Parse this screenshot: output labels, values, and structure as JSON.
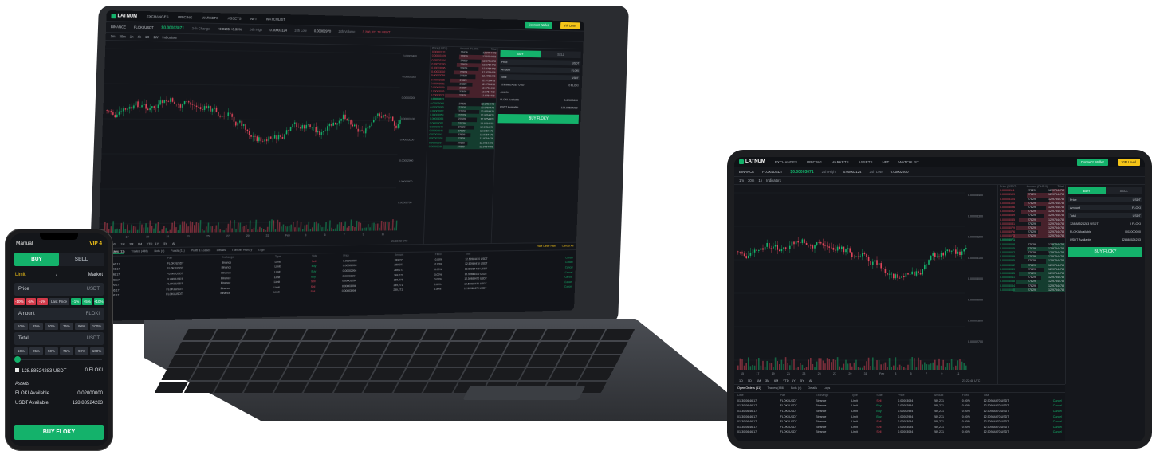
{
  "app": {
    "brand": "LATNUM",
    "nav": [
      "EXCHANGES",
      "PRICING",
      "MARKETS",
      "ASSETS",
      "NFT",
      "WATCHLIST"
    ],
    "connect_label": "Connect Wallet",
    "vip_label": "VIP Level",
    "exchange": "BINANCE",
    "pair": "FLOKI/USDT",
    "last_price": "$0.00003071",
    "stats": [
      {
        "label": "24h Change",
        "value": "+0.0105 +0.93%"
      },
      {
        "label": "24h High",
        "value": "0.00003124"
      },
      {
        "label": "24h Low",
        "value": "0.00002970"
      },
      {
        "label": "24h Volume",
        "value": "3,200,321.74 USDT"
      }
    ],
    "intervals": [
      "1m",
      "30m",
      "1h",
      "4h",
      "1D",
      "1W"
    ],
    "indicators_label": "Indicators",
    "chart_time_labels": [
      "15",
      "17",
      "19",
      "21",
      "23",
      "25",
      "27",
      "29",
      "31",
      "Feb",
      "3",
      "5",
      "7",
      "9",
      "11"
    ],
    "chart_price_labels": [
      "0.00003400",
      "0.00003300",
      "0.00003200",
      "0.00003100",
      "0.00003000",
      "0.00002900",
      "0.00002800",
      "0.00002700"
    ],
    "ranges": [
      "1D",
      "5D",
      "1M",
      "3M",
      "6M",
      "YTD",
      "1Y",
      "5Y",
      "All"
    ],
    "clock": "21:22:48 UTC",
    "orderbook_headers": [
      "Price (USDT)",
      "Amount (FLOKI)",
      "Total"
    ],
    "orderbook_mid": "0.00003071",
    "ob_asks": [
      [
        "0.00003111",
        "27829",
        "12.9754478"
      ],
      [
        "0.00003109",
        "27829",
        "12.9754478"
      ],
      [
        "0.00003104",
        "27829",
        "12.9754478"
      ],
      [
        "0.00003100",
        "27829",
        "12.9754478"
      ],
      [
        "0.00003096",
        "27829",
        "12.9754478"
      ],
      [
        "0.00003092",
        "27829",
        "12.9754478"
      ],
      [
        "0.00003089",
        "27829",
        "12.9754478"
      ],
      [
        "0.00003085",
        "27829",
        "12.9754478"
      ],
      [
        "0.00003081",
        "27829",
        "12.9754478"
      ],
      [
        "0.00003079",
        "27829",
        "12.9754478"
      ],
      [
        "0.00003076",
        "27829",
        "12.9754478"
      ],
      [
        "0.00003073",
        "27829",
        "12.9754478"
      ]
    ],
    "ob_bids": [
      [
        "0.00003068",
        "27829",
        "12.9754478"
      ],
      [
        "0.00003065",
        "27829",
        "12.9754478"
      ],
      [
        "0.00003062",
        "27829",
        "12.9754478"
      ],
      [
        "0.00003059",
        "27829",
        "12.9754478"
      ],
      [
        "0.00003055",
        "27829",
        "12.9754478"
      ],
      [
        "0.00003052",
        "27829",
        "12.9754478"
      ],
      [
        "0.00003049",
        "27829",
        "12.9754478"
      ],
      [
        "0.00003045",
        "27829",
        "12.9754478"
      ],
      [
        "0.00003041",
        "27829",
        "12.9754478"
      ],
      [
        "0.00003038",
        "27829",
        "12.9754478"
      ],
      [
        "0.00003034",
        "27829",
        "12.9754478"
      ],
      [
        "0.00003030",
        "27829",
        "12.9754478"
      ]
    ],
    "order_tabs": [
      "Open Orders (11)",
      "Trades (486)",
      "Bots (4)",
      "Funds (11)",
      "Profit & Losses",
      "Details",
      "Transfer History",
      "Logs"
    ],
    "hide_other_pairs": "Hide Other Pairs",
    "cancel_all": "Cancel All",
    "order_headers": [
      "Date",
      "Pair",
      "Exchange",
      "Type",
      "Side",
      "Price",
      "Amount",
      "Filled",
      "Total",
      ""
    ],
    "orders": [
      [
        "01-30 06:46:17",
        "FLOKI/USDT",
        "Binance",
        "Limit",
        "Sell",
        "0.00003094",
        "289,271",
        "0.00%",
        "12.50984470 USDT",
        "Cancel"
      ],
      [
        "01-30 06:46:17",
        "FLOKI/USDT",
        "Binance",
        "Limit",
        "Buy",
        "0.00002994",
        "289,271",
        "0.00%",
        "12.50984470 USDT",
        "Cancel"
      ],
      [
        "01-30 06:46:17",
        "FLOKI/USDT",
        "Binance",
        "Limit",
        "Buy",
        "0.00002994",
        "289,271",
        "0.00%",
        "12.50984470 USDT",
        "Cancel"
      ],
      [
        "01-30 06:46:17",
        "FLOKI/USDT",
        "Binance",
        "Limit",
        "Buy",
        "0.00002994",
        "289,271",
        "0.00%",
        "12.50984470 USDT",
        "Cancel"
      ],
      [
        "01-30 06:46:17",
        "FLOKI/USDT",
        "Binance",
        "Limit",
        "Sell",
        "0.00003094",
        "289,271",
        "0.00%",
        "12.50984470 USDT",
        "Cancel"
      ],
      [
        "01-30 06:46:17",
        "FLOKI/USDT",
        "Binance",
        "Limit",
        "Sell",
        "0.00003094",
        "289,271",
        "0.00%",
        "12.50984470 USDT",
        "Cancel"
      ],
      [
        "01-30 06:46:17",
        "FLOKI/USDT",
        "Binance",
        "Limit",
        "Sell",
        "0.00003094",
        "289,271",
        "0.00%",
        "12.50984470 USDT",
        "Cancel"
      ]
    ]
  },
  "trade": {
    "mode": "Manual",
    "vip": "VIP 4",
    "buy_tab": "BUY",
    "sell_tab": "SELL",
    "limit_label": "Limit",
    "separator": "/",
    "market_label": "Market",
    "price_label": "Price",
    "price_unit": "USDT",
    "price_chips": [
      "-10%",
      "-5%",
      "-1%",
      "Last Price",
      "+1%",
      "+5%",
      "+10%"
    ],
    "amount_label": "Amount",
    "amount_unit": "FLOKI",
    "pct_chips": [
      "10%",
      "25%",
      "50%",
      "75%",
      "90%",
      "100%"
    ],
    "total_label": "Total",
    "total_unit": "USDT",
    "usdt_balance": "128.88524283 USDT",
    "floki_balance": "0 FLOKI",
    "assets_label": "Assets",
    "floki_available_label": "FLOKI Available",
    "floki_available": "0.02000000",
    "usdt_available_label": "USDT Available",
    "usdt_available": "128.88524283",
    "buy_button": "BUY FLOKY"
  },
  "colors": {
    "green": "#14b26b",
    "red": "#e0455a",
    "yellow": "#f5c518",
    "bg": "#15171c"
  }
}
